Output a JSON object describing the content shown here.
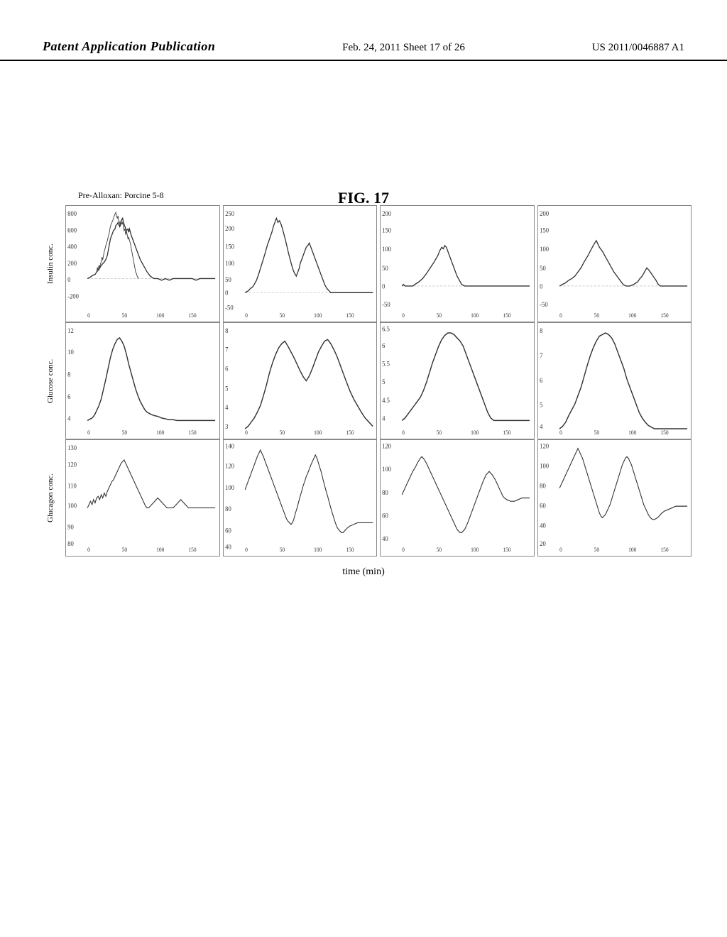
{
  "header": {
    "left": "Patent Application Publication",
    "center": "Feb. 24, 2011   Sheet 17 of 26",
    "right": "US 2011/0046887 A1"
  },
  "figure": {
    "title": "FIG. 17",
    "subtitle": "Pre-Alloxan: Porcine 5-8",
    "row_labels": [
      "Insulin conc.",
      "Glucose conc.",
      "Glucagon conc."
    ],
    "x_label": "time (min)",
    "rows": [
      {
        "label": "Insulin conc.",
        "charts": [
          {
            "y_max": 800,
            "y_min": -200,
            "y_ticks": [
              "800",
              "600",
              "400",
              "200",
              "0",
              "-200"
            ],
            "x_ticks": [
              "0",
              "50",
              "100",
              "150"
            ]
          },
          {
            "y_max": 250,
            "y_min": -50,
            "y_ticks": [
              "250",
              "200",
              "150",
              "100",
              "50",
              "0",
              "-50"
            ],
            "x_ticks": [
              "0",
              "50",
              "100",
              "150"
            ]
          },
          {
            "y_max": 200,
            "y_min": -50,
            "y_ticks": [
              "200",
              "150",
              "100",
              "50",
              "0",
              "-50"
            ],
            "x_ticks": [
              "0",
              "50",
              "100",
              "150"
            ]
          },
          {
            "y_max": 200,
            "y_min": -50,
            "y_ticks": [
              "200",
              "150",
              "100",
              "50",
              "0",
              "-50"
            ],
            "x_ticks": [
              "0",
              "50",
              "100",
              "150"
            ]
          }
        ]
      },
      {
        "label": "Glucose conc.",
        "charts": [
          {
            "y_max": 12,
            "y_min": 4,
            "y_ticks": [
              "12",
              "10",
              "8",
              "6",
              "4"
            ],
            "x_ticks": [
              "0",
              "50",
              "100",
              "150"
            ]
          },
          {
            "y_max": 8,
            "y_min": 3,
            "y_ticks": [
              "8",
              "7",
              "6",
              "5",
              "4",
              "3"
            ],
            "x_ticks": [
              "0",
              "50",
              "100",
              "150"
            ]
          },
          {
            "y_max": 6.5,
            "y_min": 4,
            "y_ticks": [
              "6.5",
              "6",
              "5.5",
              "5",
              "4.5",
              "4"
            ],
            "x_ticks": [
              "0",
              "50",
              "100",
              "150"
            ]
          },
          {
            "y_max": 8,
            "y_min": 4,
            "y_ticks": [
              "8",
              "7",
              "6",
              "5",
              "4"
            ],
            "x_ticks": [
              "0",
              "50",
              "100",
              "150"
            ]
          }
        ]
      },
      {
        "label": "Glucagon conc.",
        "charts": [
          {
            "y_max": 130,
            "y_min": 80,
            "y_ticks": [
              "130",
              "120",
              "110",
              "100",
              "90",
              "80"
            ],
            "x_ticks": [
              "0",
              "50",
              "100",
              "150"
            ]
          },
          {
            "y_max": 140,
            "y_min": 40,
            "y_ticks": [
              "140",
              "120",
              "100",
              "80",
              "60",
              "40"
            ],
            "x_ticks": [
              "0",
              "50",
              "100",
              "150"
            ]
          },
          {
            "y_max": 120,
            "y_min": 40,
            "y_ticks": [
              "120",
              "100",
              "80",
              "60",
              "40"
            ],
            "x_ticks": [
              "0",
              "50",
              "100",
              "150"
            ]
          },
          {
            "y_max": 120,
            "y_min": 20,
            "y_ticks": [
              "120",
              "100",
              "80",
              "60",
              "40",
              "20"
            ],
            "x_ticks": [
              "0",
              "50",
              "100",
              "150"
            ]
          }
        ]
      }
    ]
  }
}
